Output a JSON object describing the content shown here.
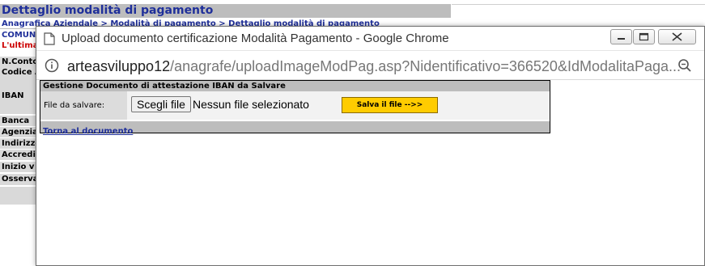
{
  "background_page": {
    "title": "Dettaglio modalità di pagamento",
    "breadcrumb": "Anagrafica Aziendale > Modalità di pagamento > Dettaglio modalità di pagamento",
    "comune_text": "COMUN",
    "ultima_text": "L'ultima",
    "field_labels": [
      "N.Conto",
      "Codice A",
      "IBAN",
      "Banca",
      "Agenzia",
      "Indirizzo",
      "Accredi",
      "Inizio v",
      "Osserva"
    ],
    "colors": {
      "header_gray": "#bdbdbd",
      "link_blue": "#1f2f9a",
      "warning_red": "#cc0000"
    }
  },
  "popup": {
    "window_title": "Upload documento certificazione Modalità Pagamento - Google Chrome",
    "url_host": "arteasviluppo12",
    "url_path": "/anagrafe/uploadImageModPag.asp?Nidentificativo=366520&IdModalitaPaga...",
    "window_controls": [
      "minimize-icon",
      "maximize-icon",
      "close-icon"
    ],
    "panel": {
      "header": "Gestione Documento di attestazione IBAN da Salvare",
      "file_label": "File da salvare:",
      "choose_file_button": "Scegli file",
      "no_file_text": "Nessun file selezionato",
      "save_button": "Salva il file -->>",
      "back_link": "Torna al documento"
    },
    "colors": {
      "save_button": "#ffcc00",
      "panel_header": "#bdbdbd"
    }
  }
}
